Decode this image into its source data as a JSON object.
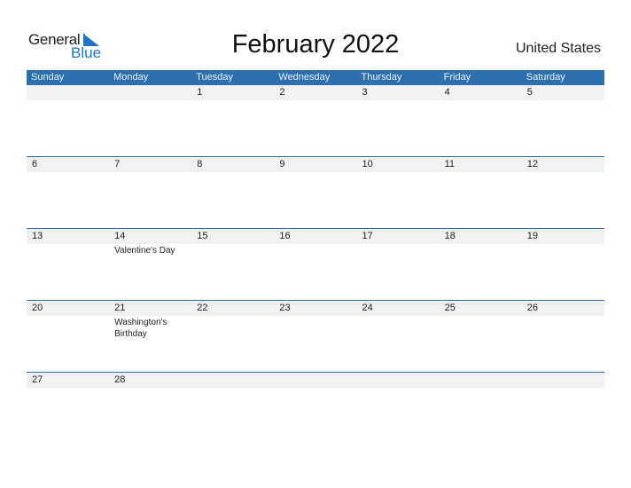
{
  "logo": {
    "general": "General",
    "blue": "Blue",
    "icon": "triangle-flag-icon"
  },
  "title": "February 2022",
  "country": "United States",
  "weekdays": [
    "Sunday",
    "Monday",
    "Tuesday",
    "Wednesday",
    "Thursday",
    "Friday",
    "Saturday"
  ],
  "colors": {
    "accent": "#2e6fb0",
    "row_band": "#f1f1f1",
    "logo_blue": "#1f74c4"
  },
  "weeks": [
    {
      "days": [
        {
          "num": "",
          "event": ""
        },
        {
          "num": "",
          "event": ""
        },
        {
          "num": "1",
          "event": ""
        },
        {
          "num": "2",
          "event": ""
        },
        {
          "num": "3",
          "event": ""
        },
        {
          "num": "4",
          "event": ""
        },
        {
          "num": "5",
          "event": ""
        }
      ]
    },
    {
      "days": [
        {
          "num": "6",
          "event": ""
        },
        {
          "num": "7",
          "event": ""
        },
        {
          "num": "8",
          "event": ""
        },
        {
          "num": "9",
          "event": ""
        },
        {
          "num": "10",
          "event": ""
        },
        {
          "num": "11",
          "event": ""
        },
        {
          "num": "12",
          "event": ""
        }
      ]
    },
    {
      "days": [
        {
          "num": "13",
          "event": ""
        },
        {
          "num": "14",
          "event": "Valentine's Day"
        },
        {
          "num": "15",
          "event": ""
        },
        {
          "num": "16",
          "event": ""
        },
        {
          "num": "17",
          "event": ""
        },
        {
          "num": "18",
          "event": ""
        },
        {
          "num": "19",
          "event": ""
        }
      ]
    },
    {
      "days": [
        {
          "num": "20",
          "event": ""
        },
        {
          "num": "21",
          "event": "Washington's Birthday"
        },
        {
          "num": "22",
          "event": ""
        },
        {
          "num": "23",
          "event": ""
        },
        {
          "num": "24",
          "event": ""
        },
        {
          "num": "25",
          "event": ""
        },
        {
          "num": "26",
          "event": ""
        }
      ]
    },
    {
      "days": [
        {
          "num": "27",
          "event": ""
        },
        {
          "num": "28",
          "event": ""
        },
        {
          "num": "",
          "event": ""
        },
        {
          "num": "",
          "event": ""
        },
        {
          "num": "",
          "event": ""
        },
        {
          "num": "",
          "event": ""
        },
        {
          "num": "",
          "event": ""
        }
      ]
    }
  ]
}
